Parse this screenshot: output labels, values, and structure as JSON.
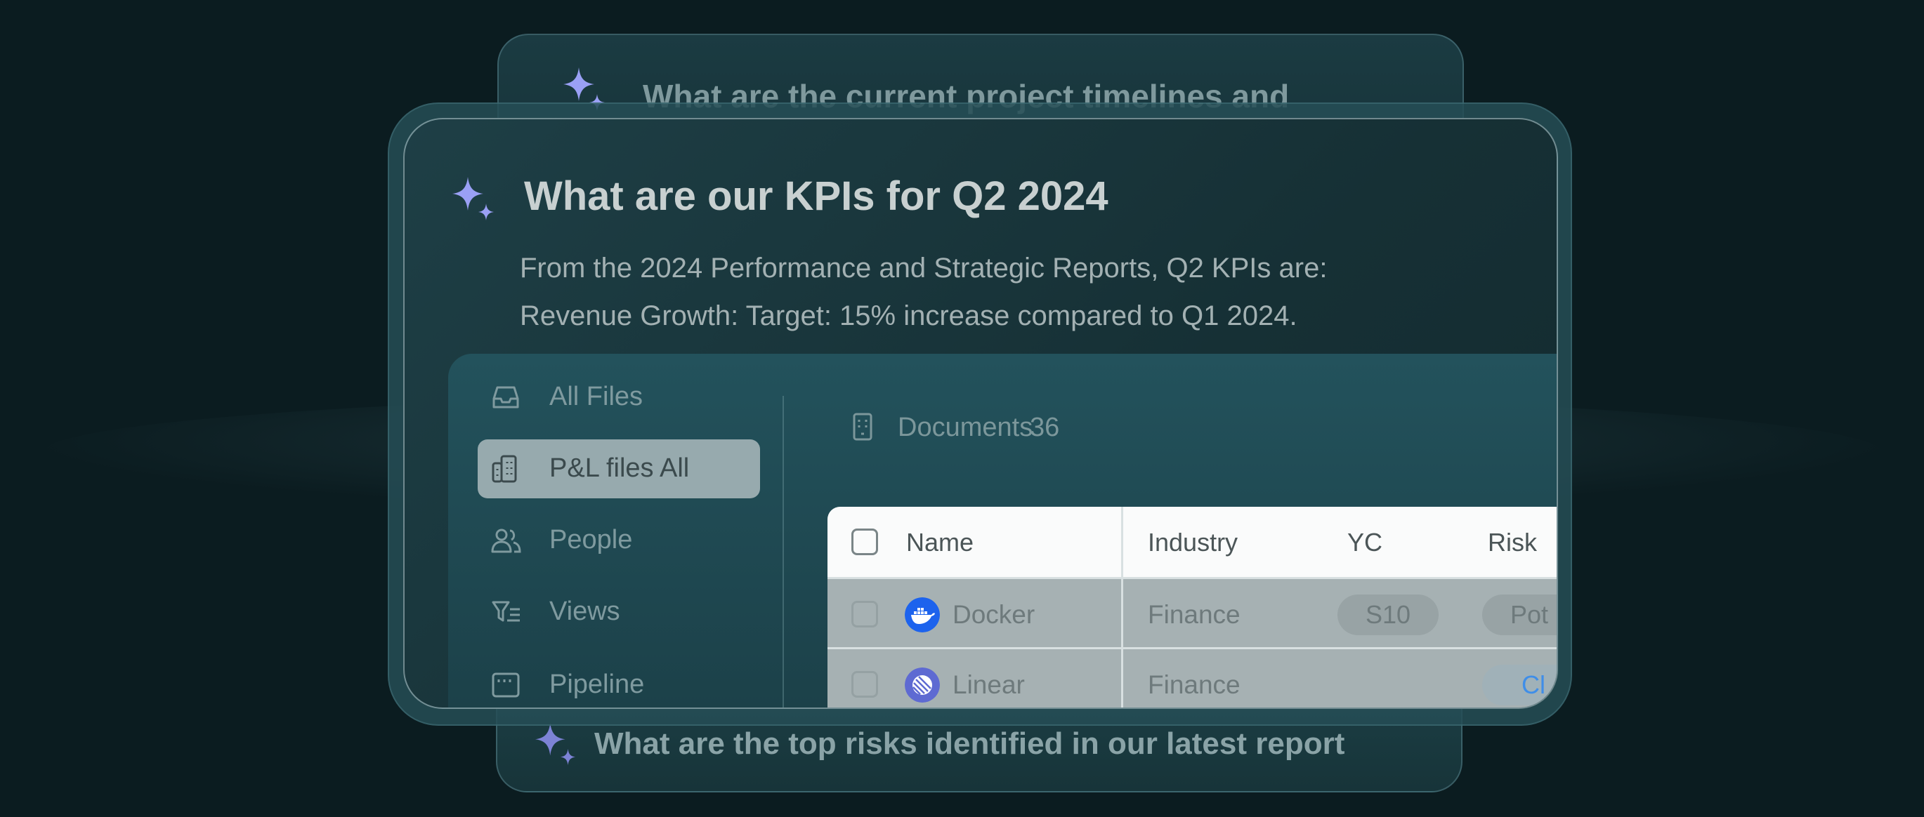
{
  "prompts": {
    "back": "What are the current project timelines and",
    "bottom": "What are the top risks identified in our latest report"
  },
  "main": {
    "question": "What are our KPIs for Q2 2024",
    "answer_line1": "From the 2024 Performance and Strategic Reports, Q2 KPIs are:",
    "answer_line2": "Revenue Growth: Target: 15% increase compared to Q1 2024."
  },
  "sidebar": {
    "items": [
      {
        "label": "All Files",
        "icon": "inbox-icon"
      },
      {
        "label": "P&L files All",
        "icon": "building-icon",
        "active": true
      },
      {
        "label": "People",
        "icon": "people-icon"
      },
      {
        "label": "Views",
        "icon": "filter-list-icon"
      },
      {
        "label": "Pipeline",
        "icon": "board-icon"
      }
    ]
  },
  "documents": {
    "label": "Documents",
    "count": "36"
  },
  "table": {
    "columns": [
      "Name",
      "Industry",
      "YC",
      "Risk"
    ],
    "rows": [
      {
        "name": "Docker",
        "industry": "Finance",
        "yc": "S10",
        "risk": "Pot",
        "logo": "docker-logo"
      },
      {
        "name": "Linear",
        "industry": "Finance",
        "yc": "",
        "risk": "Cl",
        "logo": "linear-logo"
      }
    ]
  },
  "colors": {
    "sparkle": "#9aa0f5",
    "background": "#0b1c20",
    "docker": "#1d63ed",
    "linear": "#5e6ad2",
    "risk_link": "#3f8ee8"
  }
}
